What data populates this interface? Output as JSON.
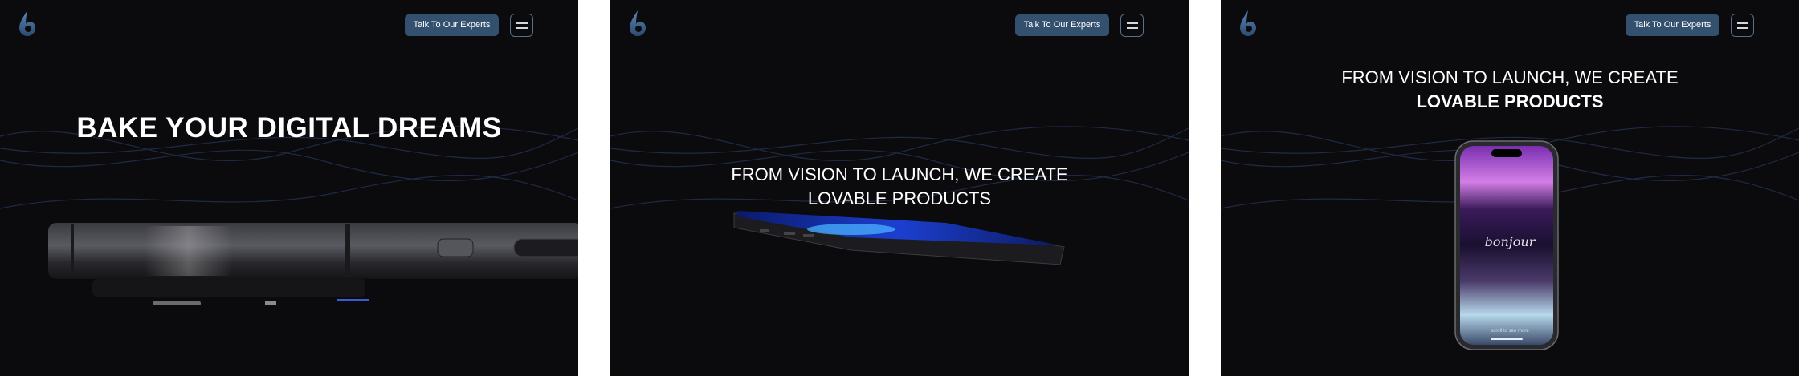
{
  "header": {
    "cta_label": "Talk To Our Experts",
    "logo_icon": "droplet-logo-icon",
    "menu_icon": "hamburger-menu-icon"
  },
  "slides": [
    {
      "title": "BAKE YOUR DIGITAL DREAMS"
    },
    {
      "tagline_line1": "FROM VISION TO LAUNCH, WE CREATE",
      "tagline_line2": "LOVABLE PRODUCTS"
    },
    {
      "tagline_line1": "FROM VISION TO LAUNCH, WE CREATE",
      "tagline_line2": "LOVABLE PRODUCTS",
      "phone_greeting": "bonjour",
      "phone_hint": "scroll to see more"
    }
  ],
  "colors": {
    "background": "#0b0b0d",
    "cta": "#34506f",
    "accent_blue": "#3a6fd8"
  }
}
